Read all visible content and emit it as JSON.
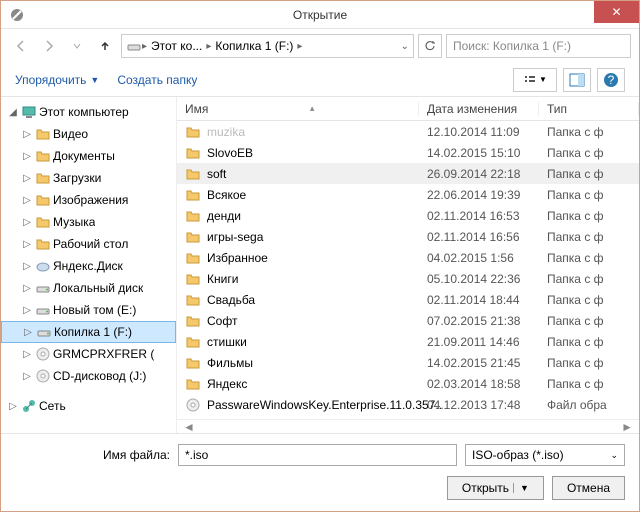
{
  "title": "Открытие",
  "breadcrumb": {
    "seg1": "Этот ко...",
    "seg2": "Копилка 1 (F:)"
  },
  "search_placeholder": "Поиск: Копилка 1 (F:)",
  "toolbar": {
    "organize": "Упорядочить",
    "new_folder": "Создать папку"
  },
  "tree": {
    "computer": "Этот компьютер",
    "items": [
      "Видео",
      "Документы",
      "Загрузки",
      "Изображения",
      "Музыка",
      "Рабочий стол",
      "Яндекс.Диск",
      "Локальный диск",
      "Новый том (E:)",
      "Копилка 1 (F:)",
      "GRMCPRXFRER (",
      "CD-дисковод (J:)"
    ],
    "network": "Сеть"
  },
  "columns": {
    "name": "Имя",
    "date": "Дата изменения",
    "type": "Тип"
  },
  "files": [
    {
      "name": "muzika",
      "date": "12.10.2014 11:09",
      "type": "Папка с ф",
      "kind": "folder",
      "faded": true
    },
    {
      "name": "SlovoEB",
      "date": "14.02.2015 15:10",
      "type": "Папка с ф",
      "kind": "folder"
    },
    {
      "name": "soft",
      "date": "26.09.2014 22:18",
      "type": "Папка с ф",
      "kind": "folder",
      "sel": true
    },
    {
      "name": "Всякое",
      "date": "22.06.2014 19:39",
      "type": "Папка с ф",
      "kind": "folder"
    },
    {
      "name": "денди",
      "date": "02.11.2014 16:53",
      "type": "Папка с ф",
      "kind": "folder"
    },
    {
      "name": "игры-sega",
      "date": "02.11.2014 16:56",
      "type": "Папка с ф",
      "kind": "folder"
    },
    {
      "name": "Избранное",
      "date": "04.02.2015 1:56",
      "type": "Папка с ф",
      "kind": "folder"
    },
    {
      "name": "Книги",
      "date": "05.10.2014 22:36",
      "type": "Папка с ф",
      "kind": "folder"
    },
    {
      "name": "Свадьба",
      "date": "02.11.2014 18:44",
      "type": "Папка с ф",
      "kind": "folder"
    },
    {
      "name": "Софт",
      "date": "07.02.2015 21:38",
      "type": "Папка с ф",
      "kind": "folder"
    },
    {
      "name": "стишки",
      "date": "21.09.2011 14:46",
      "type": "Папка с ф",
      "kind": "folder"
    },
    {
      "name": "Фильмы",
      "date": "14.02.2015 21:45",
      "type": "Папка с ф",
      "kind": "folder"
    },
    {
      "name": "Яндекс",
      "date": "02.03.2014 18:58",
      "type": "Папка с ф",
      "kind": "folder"
    },
    {
      "name": "PasswareWindowsKey.Enterprise.11.0.357..",
      "date": "04.12.2013 17:48",
      "type": "Файл обра",
      "kind": "iso"
    }
  ],
  "filename": {
    "label": "Имя файла:",
    "value": "*.iso"
  },
  "filetype": "ISO-образ (*.iso)",
  "buttons": {
    "open": "Открыть",
    "cancel": "Отмена"
  }
}
